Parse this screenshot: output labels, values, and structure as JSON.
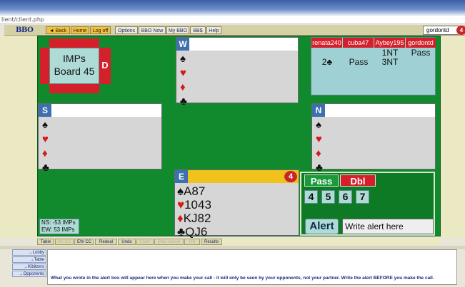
{
  "browser": {
    "url_fragment": "lient/client.php"
  },
  "toolbar": {
    "logo": "BBO",
    "buttons": [
      "◄ Back",
      "Home",
      "Log off",
      "Options",
      "BBO Now",
      "My BBO",
      "BB$",
      "Help"
    ],
    "username": "gordontd",
    "notification_count": "4"
  },
  "info": {
    "scoring": "IMPs",
    "board": "Board 45",
    "dealer": "D"
  },
  "hands": {
    "west": {
      "seat": "W",
      "spades": "",
      "hearts": "",
      "diamonds": "",
      "clubs": ""
    },
    "south": {
      "seat": "S",
      "spades": "",
      "hearts": "",
      "diamonds": "",
      "clubs": ""
    },
    "north": {
      "seat": "N",
      "spades": "",
      "hearts": "",
      "diamonds": "",
      "clubs": ""
    },
    "east": {
      "seat": "E",
      "spades": "A87",
      "hearts": "1043",
      "diamonds": "KJ82",
      "clubs": "QJ6",
      "badge": "4"
    }
  },
  "suit_symbols": {
    "spade": "♠",
    "heart": "♥",
    "diamond": "♦",
    "club": "♣"
  },
  "bidding": {
    "players": [
      "renata240",
      "cuba47",
      "Aybey195",
      "gordontd"
    ],
    "calls": [
      [
        "",
        "",
        "1NT",
        "Pass"
      ],
      [
        "2♣",
        "Pass",
        "3NT",
        ""
      ]
    ]
  },
  "call_panel": {
    "pass": "Pass",
    "dbl": "Dbl",
    "levels": [
      "4",
      "5",
      "6",
      "7"
    ],
    "alert_button": "Alert",
    "alert_text": "Write alert here"
  },
  "score": {
    "ns": "NS: -53 IMPs",
    "ew": "EW: 53 IMPs"
  },
  "tabs": [
    "Table",
    "NS CC",
    "EW CC",
    "Redeal",
    "Undo",
    "Claim",
    "Deal source",
    "OB",
    "Results"
  ],
  "chat": {
    "tabs": [
      "→Lobby",
      "→Table",
      "→Kibitzers",
      "→Opponents"
    ],
    "message": "What you wrote in the alert box will appear here when you make your call - it will only be seen by your opponents, not your partner. Write the alert BEFORE you make the call."
  },
  "colors": {
    "felt": "#108a2c",
    "accent_red": "#d4202a",
    "panel_teal": "#aedbd6",
    "east_header": "#f2c21c"
  }
}
